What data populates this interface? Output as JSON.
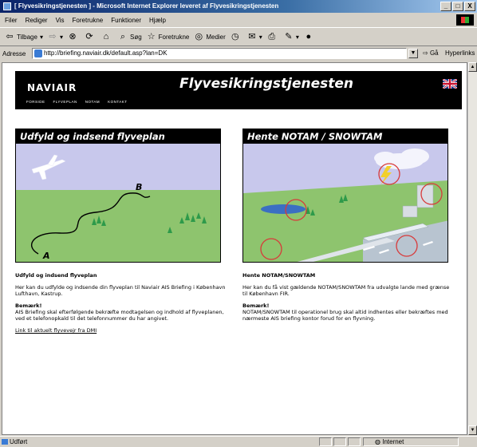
{
  "window": {
    "title": "[ Flyvesikringstjenesten ] - Microsoft Internet Explorer leveret af Flyvesikringstjenesten",
    "controls": [
      "_",
      "□",
      "X"
    ]
  },
  "menu": [
    "Filer",
    "Rediger",
    "Vis",
    "Foretrukne",
    "Funktioner",
    "Hjælp"
  ],
  "toolbar": {
    "back": "Tilbage",
    "search": "Søg",
    "favorites": "Foretrukne",
    "media": "Medier"
  },
  "address": {
    "label": "Adresse",
    "url": "http://briefing.naviair.dk/default.asp?lan=DK",
    "go": "Gå",
    "links": "Hyperlinks"
  },
  "status": {
    "text": "Udført",
    "zone": "Internet"
  },
  "site": {
    "logo": "NAVIAIR",
    "title": "Flyvesikringstjenesten",
    "nav": [
      "FORSIDE",
      "FLYVEPLAN",
      "NOTAM",
      "KONTAKT"
    ]
  },
  "left": {
    "panel_title": "Udfyld og indsend flyveplan",
    "map_label_a": "A",
    "map_label_b": "B",
    "heading": "Udfyld og indsend flyveplan",
    "para1": "Her kan du udfylde og indsende din flyveplan til Naviair AIS Briefing i København Lufthavn, Kastrup.",
    "note_title": "Bemærk!",
    "note_text": "AIS Briefing skal efterfølgende bekræfte modtagelsen og indhold af flyveplanen, ved et telefonopkald til det telefonnummer du har angivet.",
    "link": "Link til aktuelt flyvevejr fra DMI"
  },
  "right": {
    "panel_title": "Hente NOTAM / SNOWTAM",
    "heading": "Hente NOTAM/SNOWTAM",
    "para1": "Her kan du få vist gældende NOTAM/SNOWTAM fra udvalgte lande med grænse til København FIR.",
    "note_title": "Bemærk!",
    "note_text": "NOTAM/SNOWTAM til operationel brug skal altid indhentes eller bekræftes med nærmeste AIS briefing kontor forud for en flyvning."
  },
  "colors": {
    "sky": "#c8c8ec",
    "grass": "#8ec46e",
    "tree": "#2e9a4a",
    "circle": "#d83a3a",
    "header_bg": "#000000"
  }
}
